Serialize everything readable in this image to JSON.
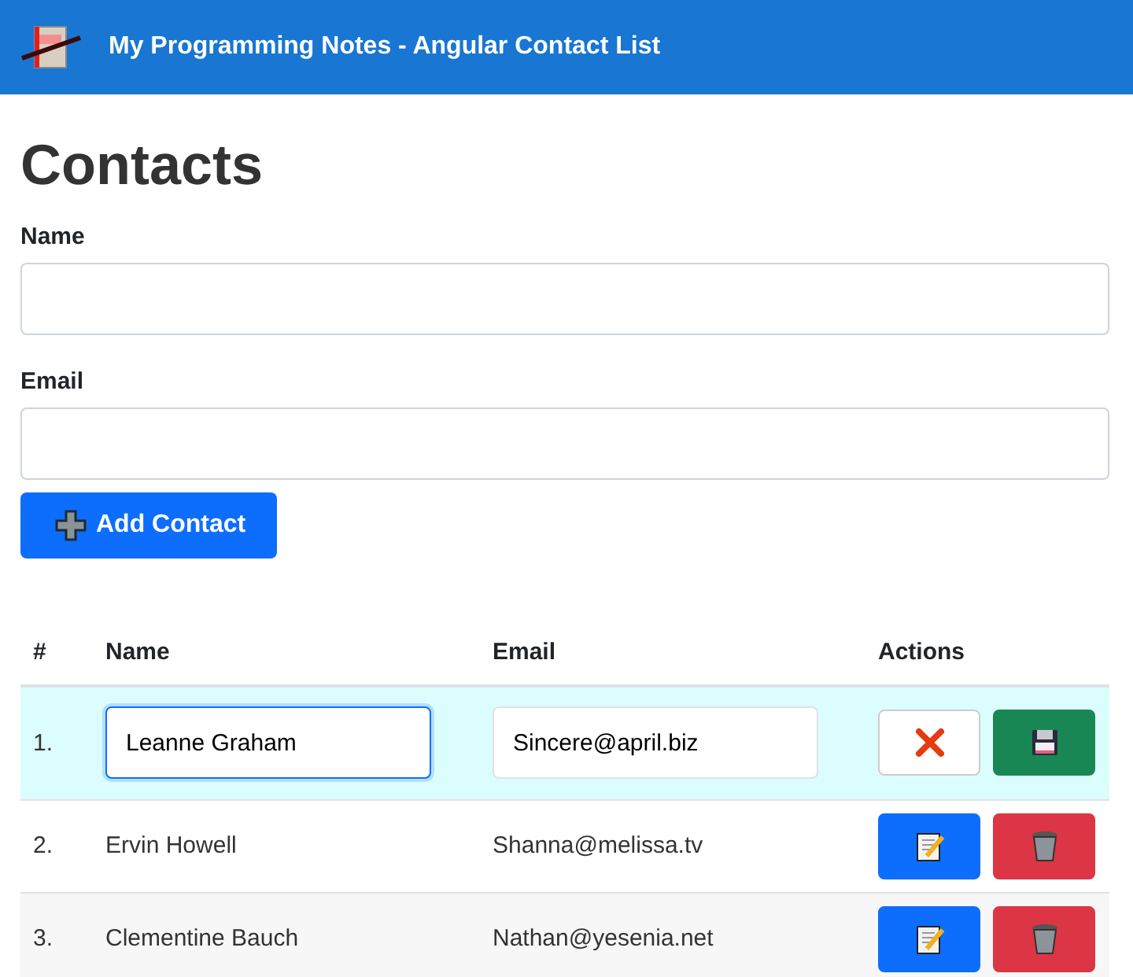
{
  "navbar": {
    "title": "My Programming Notes - Angular Contact List"
  },
  "heading": "Contacts",
  "form": {
    "fields": [
      {
        "label": "Name"
      },
      {
        "label": "Email"
      }
    ],
    "submit": "Add Contact"
  },
  "table": {
    "columns": [
      "#",
      "Name",
      "Email",
      "Actions"
    ],
    "rows": [
      {
        "number": "1.",
        "name": "Leanne Graham",
        "email": "Sincere@april.biz",
        "editing": true
      },
      {
        "number": "2.",
        "name": "Ervin Howell",
        "email": "Shanna@melissa.tv",
        "editing": false
      },
      {
        "number": "3.",
        "name": "Clementine Bauch",
        "email": "Nathan@yesenia.net",
        "editing": false
      }
    ]
  }
}
